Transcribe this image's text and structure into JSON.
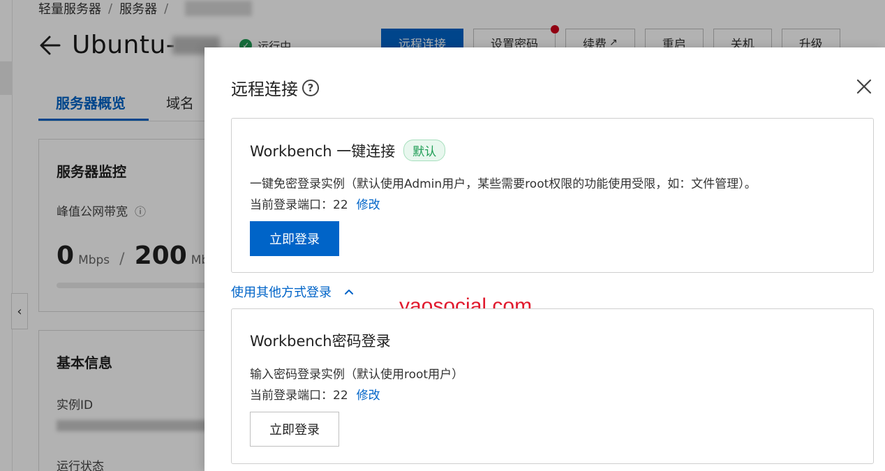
{
  "breadcrumb": [
    "轻量服务器",
    "服务器"
  ],
  "server": {
    "title": "Ubuntu-",
    "status": "运行中",
    "actions": [
      "远程连接",
      "设置密码",
      "续费",
      "重启",
      "关机",
      "升级"
    ]
  },
  "tabs": [
    "服务器概览",
    "域名"
  ],
  "monitor": {
    "title": "服务器监控",
    "bandwidth_label": "峰值公网带宽",
    "current_value": "0",
    "current_unit": "Mbps",
    "max_value": "200",
    "max_unit": "Mb"
  },
  "basic_info": {
    "title": "基本信息",
    "instance_id_label": "实例ID",
    "run_state_label": "运行状态"
  },
  "drawer": {
    "title": "远程连接",
    "panel1": {
      "title": "Workbench 一键连接",
      "badge": "默认",
      "description": "一键免密登录实例（默认使用Admin用户，某些需要root权限的功能使用受限，如：文件管理）。",
      "port_label": "当前登录端口：22",
      "modify_link": "修改",
      "login_button": "立即登录"
    },
    "other_methods": "使用其他方式登录",
    "panel2": {
      "title": "Workbench密码登录",
      "description": "输入密码登录实例（默认使用root用户）",
      "port_label": "当前登录端口：22",
      "modify_link": "修改",
      "login_button": "立即登录"
    }
  },
  "watermark": "yaosocial.com",
  "colors": {
    "primary": "#0064c8",
    "success": "#1f9d55",
    "badge_dot": "#d0021b",
    "watermark": "#e0192d"
  },
  "icons": {
    "back": "back-arrow-icon",
    "status": "check-circle-icon",
    "external": "external-link-icon",
    "help": "question-circle-icon",
    "close": "close-icon",
    "chevron": "chevron-up-icon",
    "collapse": "chevron-left-icon"
  }
}
